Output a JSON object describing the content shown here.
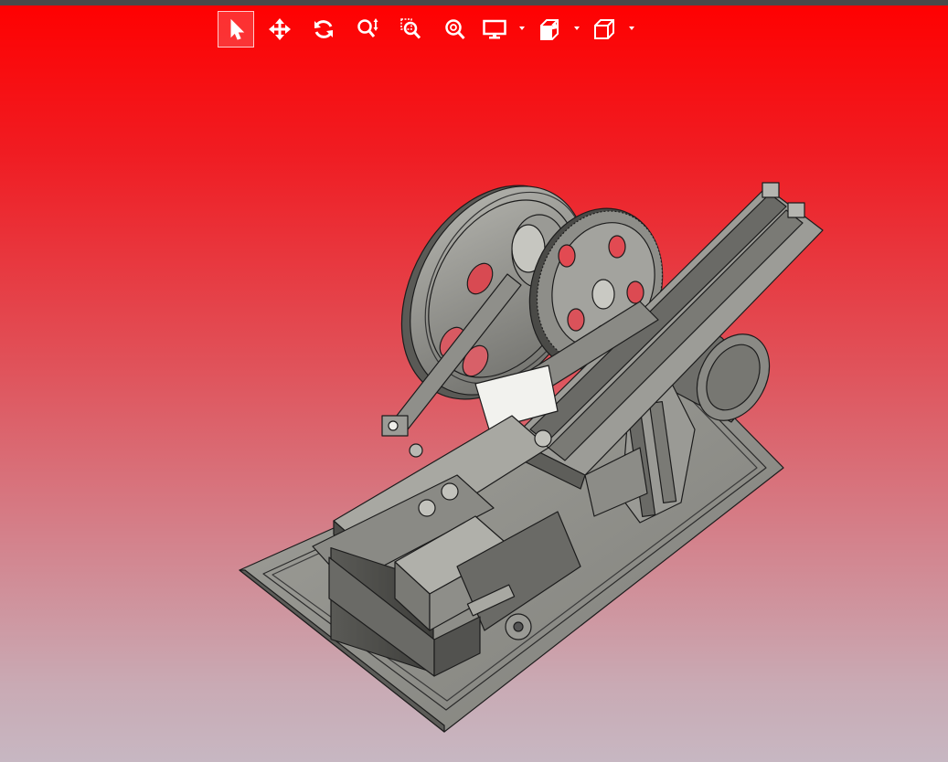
{
  "viewer": {
    "background_top": "#ff0000",
    "background_bottom": "#c7b7c2"
  },
  "toolbar": {
    "tools": [
      {
        "name": "select-tool",
        "icon": "arrow-cursor-icon",
        "active": true
      },
      {
        "name": "pan-tool",
        "icon": "move-arrows-icon",
        "active": false
      },
      {
        "name": "rotate-tool",
        "icon": "rotate-icon",
        "active": false
      },
      {
        "name": "zoom-tool",
        "icon": "zoom-updown-icon",
        "active": false
      },
      {
        "name": "zoom-window-tool",
        "icon": "zoom-window-icon",
        "active": false
      },
      {
        "name": "zoom-fit-tool",
        "icon": "zoom-fit-icon",
        "active": false
      },
      {
        "name": "display-mode-dropdown",
        "icon": "monitor-icon",
        "active": false
      },
      {
        "name": "section-view-dropdown",
        "icon": "section-cube-icon",
        "active": false
      },
      {
        "name": "standard-views-dropdown",
        "icon": "cube-icon",
        "active": false
      }
    ]
  },
  "model": {
    "kind": "mechanical-assembly-3d",
    "colors": {
      "part_fill": "#8f8f8b",
      "part_edge": "#1c1c1c",
      "highlight": "#f0f0ec"
    }
  }
}
